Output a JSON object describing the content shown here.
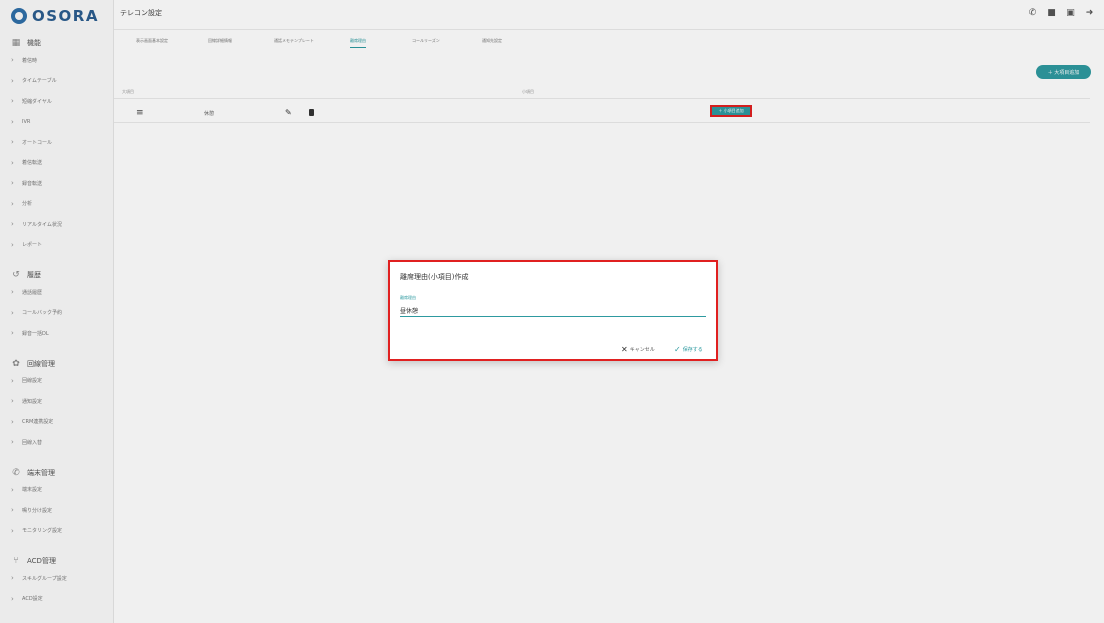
{
  "app": {
    "logo_text": "OSORA",
    "page_title": "テレコン設定"
  },
  "colors": {
    "accent": "#2e9aa0",
    "highlight": "#e02020",
    "brand": "#2b5d8f"
  },
  "top_icons": [
    "phone-icon",
    "save-icon",
    "id-card-icon",
    "logout-icon"
  ],
  "sidebar": {
    "sections": [
      {
        "icon": "grid-icon",
        "label": "機能",
        "items": [
          "着信時",
          "タイムテーブル",
          "短縮ダイヤル",
          "IVR",
          "オートコール",
          "着信転送",
          "録音転送",
          "分析",
          "リアルタイム状況",
          "レポート"
        ]
      },
      {
        "icon": "history-icon",
        "label": "履歴",
        "items": [
          "通話履歴",
          "コールバック予約",
          "録音一括DL"
        ]
      },
      {
        "icon": "gear-icon",
        "label": "回線管理",
        "items": [
          "回線設定",
          "通知設定",
          "CRM連携設定",
          "回線入替"
        ]
      },
      {
        "icon": "phone-icon",
        "label": "端末管理",
        "items": [
          "端末設定",
          "鳴り分け設定",
          "モニタリング設定"
        ]
      },
      {
        "icon": "acd-icon",
        "label": "ACD管理",
        "items": [
          "スキルグループ設定",
          "ACD設定"
        ]
      }
    ]
  },
  "tabs": [
    {
      "label": "表示画面基本設定"
    },
    {
      "label": "回線詳細情報"
    },
    {
      "label": "通話メモテンプレート"
    },
    {
      "label": "離席理由",
      "active": true
    },
    {
      "label": "コールリーズン"
    },
    {
      "label": "通知先設定"
    }
  ],
  "add_major_label": "＋ 大項目追加",
  "table": {
    "col_major": "大項目",
    "col_minor": "小項目",
    "rows": [
      {
        "name": "休憩",
        "add_minor_label": "＋ 小項目追加"
      }
    ]
  },
  "dialog": {
    "title": "離席理由(小項目)作成",
    "field_label": "離席理由",
    "field_value": "昼休憩",
    "cancel_label": "キャンセル",
    "save_label": "保存する"
  }
}
